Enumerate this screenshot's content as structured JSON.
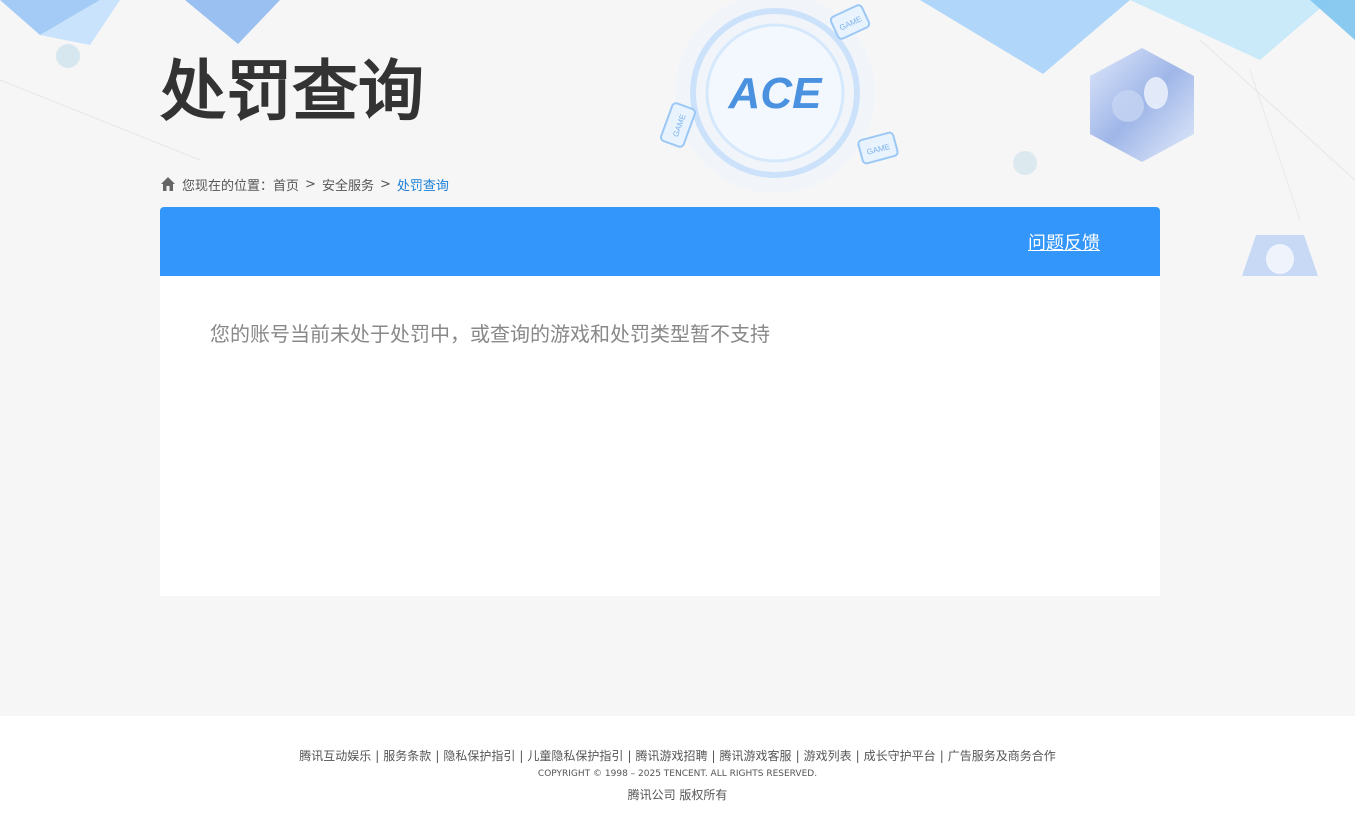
{
  "header": {
    "title": "处罚查询",
    "logo_text": "ACE",
    "game_badge": "GAME"
  },
  "breadcrumb": {
    "prefix": "您现在的位置：",
    "items": [
      "首页",
      "安全服务",
      "处罚查询"
    ],
    "separator": ">"
  },
  "panel": {
    "feedback_label": "问题反馈",
    "message": "您的账号当前未处于处罚中，或查询的游戏和处罚类型暂不支持"
  },
  "footer": {
    "links": [
      "腾讯互动娱乐",
      "服务条款",
      "隐私保护指引",
      "儿童隐私保护指引",
      "腾讯游戏招聘",
      "腾讯游戏客服",
      "游戏列表",
      "成长守护平台",
      "广告服务及商务合作"
    ],
    "separator": "|",
    "copyright": "COPYRIGHT © 1998 – 2025 TENCENT. ALL RIGHTS RESERVED.",
    "company": "腾讯公司 版权所有"
  },
  "colors": {
    "accent": "#3396fb",
    "link_current": "#1b7fd6",
    "background": "#f6f6f6"
  }
}
